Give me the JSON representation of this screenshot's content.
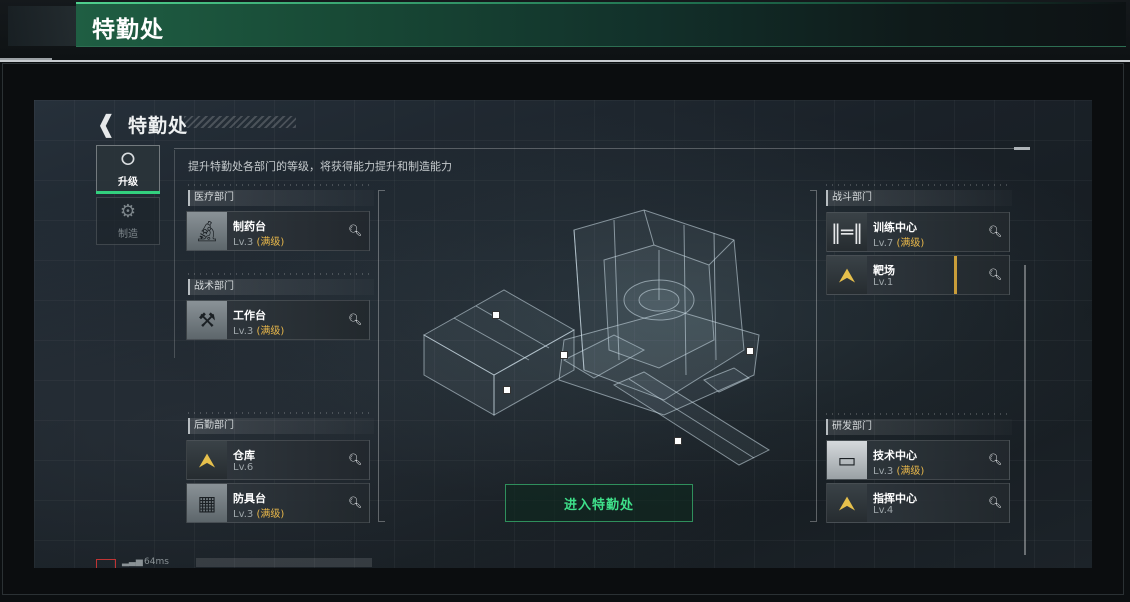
{
  "banner": {
    "title": "特勤处"
  },
  "header": {
    "back_icon": "back-arrow-icon",
    "title": "特勤处",
    "description": "提升特勤处各部门的等级，将获得能力提升和制造能力"
  },
  "tabs": [
    {
      "label": "升级",
      "icon": "upgrade-icon",
      "active": true
    },
    {
      "label": "制造",
      "icon": "gears-icon",
      "active": false
    }
  ],
  "departments": {
    "medical": {
      "name": "医疗部门",
      "facilities": [
        {
          "name": "制药台",
          "level": "Lv.3",
          "status": "(满级)",
          "icon": "microscope-icon"
        }
      ]
    },
    "tactical": {
      "name": "战术部门",
      "facilities": [
        {
          "name": "工作台",
          "level": "Lv.3",
          "status": "(满级)",
          "icon": "hammer-wrench-icon"
        }
      ]
    },
    "logistics": {
      "name": "后勤部门",
      "facilities": [
        {
          "name": "仓库",
          "level": "Lv.6",
          "status": "",
          "icon": "chevron-rank-icon"
        },
        {
          "name": "防具台",
          "level": "Lv.3",
          "status": "(满级)",
          "icon": "cubes-icon"
        }
      ]
    },
    "combat": {
      "name": "战斗部门",
      "facilities": [
        {
          "name": "训练中心",
          "level": "Lv.7",
          "status": "(满级)",
          "icon": "dumbbell-icon"
        },
        {
          "name": "靶场",
          "level": "Lv.1",
          "status": "",
          "icon": "gold-rank-icon"
        }
      ]
    },
    "research": {
      "name": "研发部门",
      "facilities": [
        {
          "name": "技术中心",
          "level": "Lv.3",
          "status": "(满级)",
          "icon": "monitor-icon"
        },
        {
          "name": "指挥中心",
          "level": "Lv.4",
          "status": "",
          "icon": "gold-chevrons-icon"
        }
      ]
    }
  },
  "center": {
    "enter_button": "进入特勤处"
  },
  "status_bar": {
    "ping": "64ms"
  },
  "colors": {
    "accent_green": "#3ee08a",
    "maxed_gold": "#e8b74a",
    "banner_green": "#1f5e43"
  }
}
